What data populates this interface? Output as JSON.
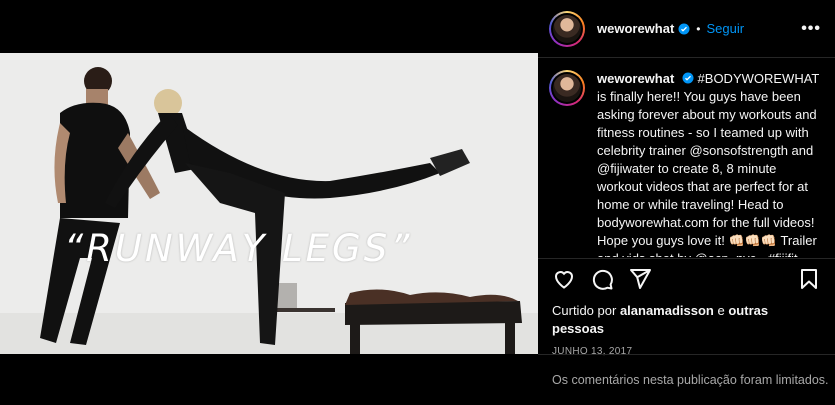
{
  "post": {
    "overlay_text": "“RUNWAY LEGS”"
  },
  "header": {
    "username": "weworewhat",
    "separator": "•",
    "follow_label": "Seguir",
    "more_label": "•••"
  },
  "caption": {
    "username": "weworewhat",
    "text": "#BODYWOREWHAT is finally here!! You guys have been asking forever about my workouts and fitness routines - so I teamed up with celebrity trainer @sonsofstrength and @fijiwater to create 8, 8 minute workout videos that are perfect for at home or while traveling! Head to bodyworewhat.com for the full videos! Hope you guys love it! 👊🏻👊🏻👊🏻 Trailer and vids shot by @acp_nyc • #fijifit"
  },
  "likes": {
    "prefix": "Curtido por",
    "user": "alanamadisson",
    "conjunction": "e",
    "others": "outras pessoas"
  },
  "date": "JUNHO 13, 2017",
  "comments_notice": "Os comentários nesta publicação foram limitados.",
  "colors": {
    "accent": "#0095f6",
    "background": "#000000",
    "muted": "#a8a8a8"
  }
}
